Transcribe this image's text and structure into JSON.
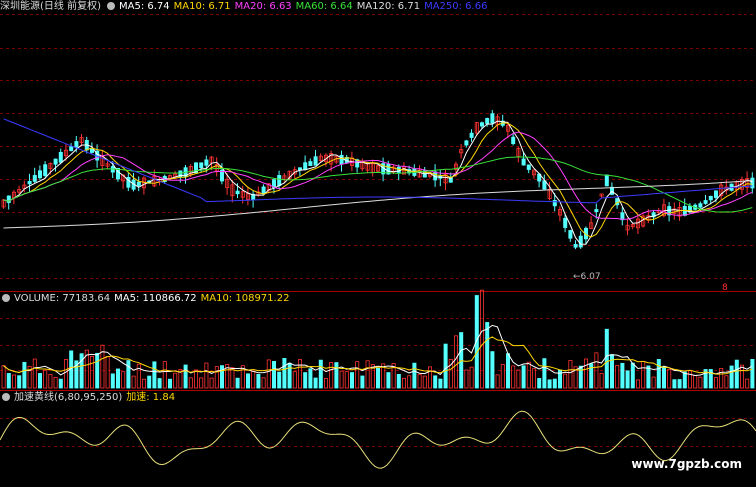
{
  "title_row": {
    "stock": "深圳能源(日线 前复权)",
    "mas": [
      {
        "label": "MA5: 6.74",
        "color": "#ffffff"
      },
      {
        "label": "MA10: 6.71",
        "color": "#ffd700"
      },
      {
        "label": "MA20: 6.63",
        "color": "#ff40ff"
      },
      {
        "label": "MA60: 6.64",
        "color": "#39e339"
      },
      {
        "label": "MA120: 6.71",
        "color": "#dddddd"
      },
      {
        "label": "MA250: 6.66",
        "color": "#3a3aff"
      }
    ]
  },
  "low_annotation": "6.07",
  "volume_row": {
    "label": "VOLUME: 77183.64",
    "ma5": "MA5: 110866.72",
    "ma10": "MA10: 108971.22"
  },
  "indicator_row": {
    "name": "加速黄线(6,80,95,250)",
    "value": "加速: 1.84"
  },
  "watermark": "www.7gpzb.com",
  "colors": {
    "up": "#ff3232",
    "down": "#54ffff",
    "grid": "#7a0000",
    "ma5": "#ffffff",
    "ma10": "#ffd700",
    "ma20": "#ff40ff",
    "ma60": "#39e339",
    "ma120": "#dddddd",
    "ma250": "#3a3aff",
    "accel": "#e8e07a"
  }
}
